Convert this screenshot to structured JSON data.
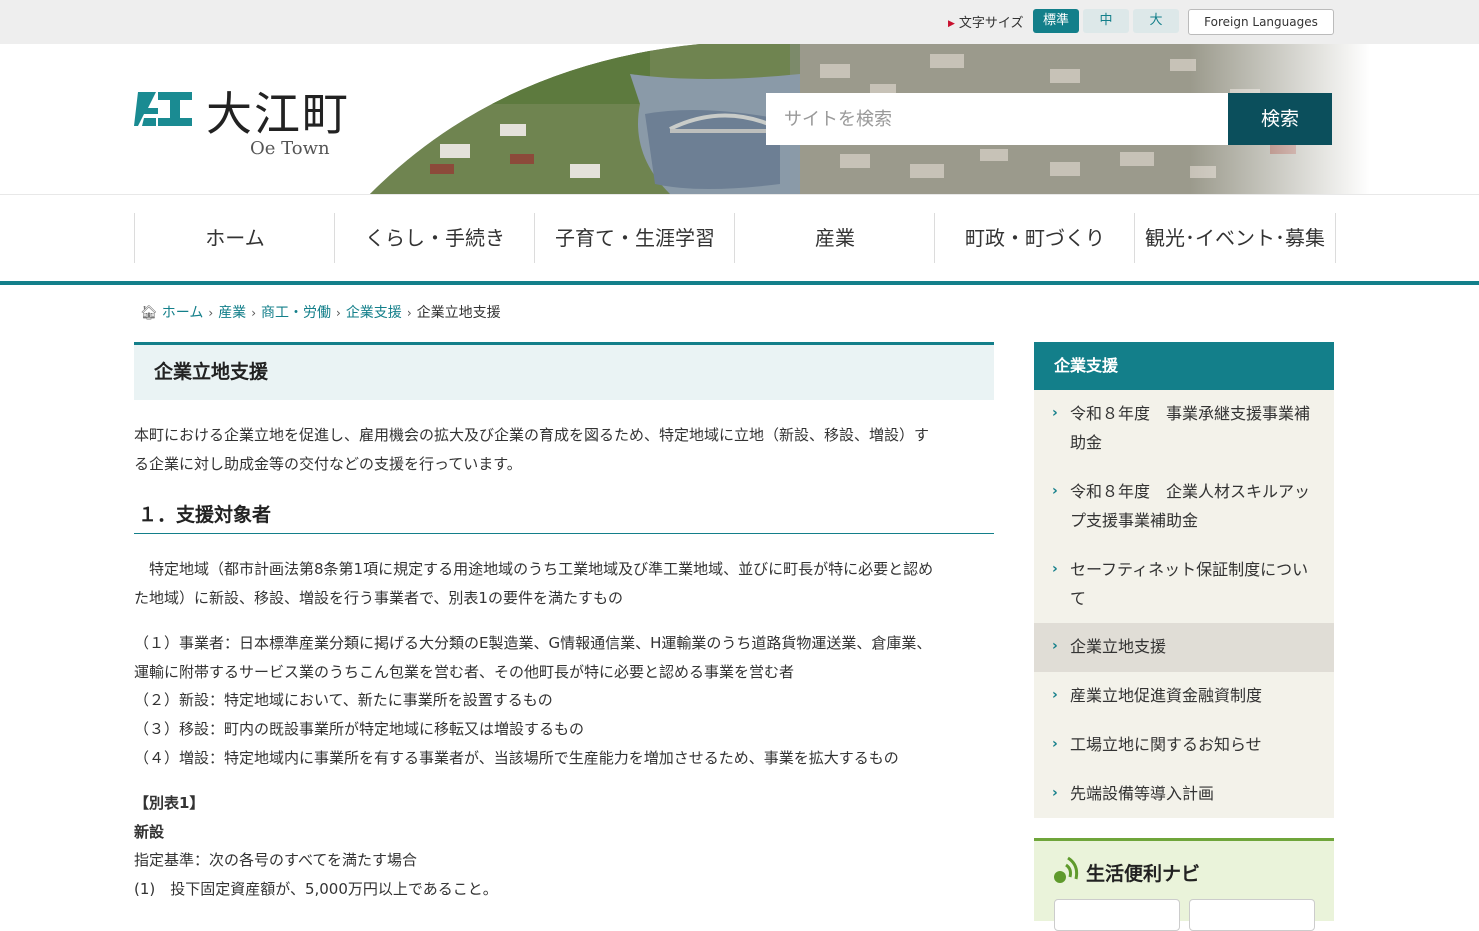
{
  "topbar": {
    "font_size_label": "文字サイズ",
    "sizes": [
      "標準",
      "中",
      "大"
    ],
    "foreign": "Foreign Languages"
  },
  "header": {
    "logo_jp": "大江町",
    "logo_en": "Oe Town",
    "search_placeholder": "サイトを検索",
    "search_button": "検索"
  },
  "nav": [
    "ホーム",
    "くらし・手続き",
    "子育て・生涯学習",
    "産業",
    "町政・町づくり",
    "観光･イベント･募集"
  ],
  "breadcrumb": {
    "items": [
      "ホーム",
      "産業",
      "商工・労働",
      "企業支援"
    ],
    "current": "企業立地支援"
  },
  "main": {
    "title": "企業立地支援",
    "intro_1": "本町における企業立地を促進し、雇用機会の拡大及び企業の育成を図るため、特定地域に立地（新設、移設、増設）す",
    "intro_2": "る企業に対し助成金等の交付などの支援を行っています。",
    "section1_heading": "１．支援対象者",
    "s1_p1a": "　特定地域（都市計画法第8条第1項に規定する用途地域のうち工業地域及び準工業地域、並びに町長が特に必要と認め",
    "s1_p1b": "た地域）に新設、移設、増設を行う事業者で、別表1の要件を満たすもの",
    "s1_l1a": "（１）事業者：日本標準産業分類に掲げる大分類のE製造業、G情報通信業、H運輸業のうち道路貨物運送業、倉庫業、",
    "s1_l1b": "運輸に附帯するサービス業のうちこん包業を営む者、その他町長が特に必要と認める事業を営む者",
    "s1_l2": "（２）新設：特定地域において、新たに事業所を設置するもの",
    "s1_l3": "（３）移設：町内の既設事業所が特定地域に移転又は増設するもの",
    "s1_l4": "（４）増設：特定地域内に事業所を有する事業者が、当該場所で生産能力を増加させるため、事業を拡大するもの",
    "table_label": "【別表1】",
    "new_label": "新設",
    "criteria": "指定基準：次の各号のすべてを満たす場合",
    "criteria_1": "(1)　投下固定資産額が、5,000万円以上であること。"
  },
  "sidebar": {
    "heading": "企業支援",
    "items": [
      {
        "l1": "令和８年度　事業承継支援事業補",
        "l2": "助金"
      },
      {
        "l1": "令和８年度　企業人材スキルアッ",
        "l2": "プ支援事業補助金"
      },
      {
        "l1": "セーフティネット保証制度につい",
        "l2": "て"
      },
      {
        "l1": "企業立地支援",
        "l2": ""
      },
      {
        "l1": "産業立地促進資金融資制度",
        "l2": ""
      },
      {
        "l1": "工場立地に関するお知らせ",
        "l2": ""
      },
      {
        "l1": "先端設備等導入計画",
        "l2": ""
      }
    ],
    "navi_title": "生活便利ナビ"
  },
  "colors": {
    "accent": "#137f8a",
    "accent_dark": "#0b4f5c",
    "sidebar_bg": "#f3f2ea",
    "navi_green": "#6fa53a"
  }
}
